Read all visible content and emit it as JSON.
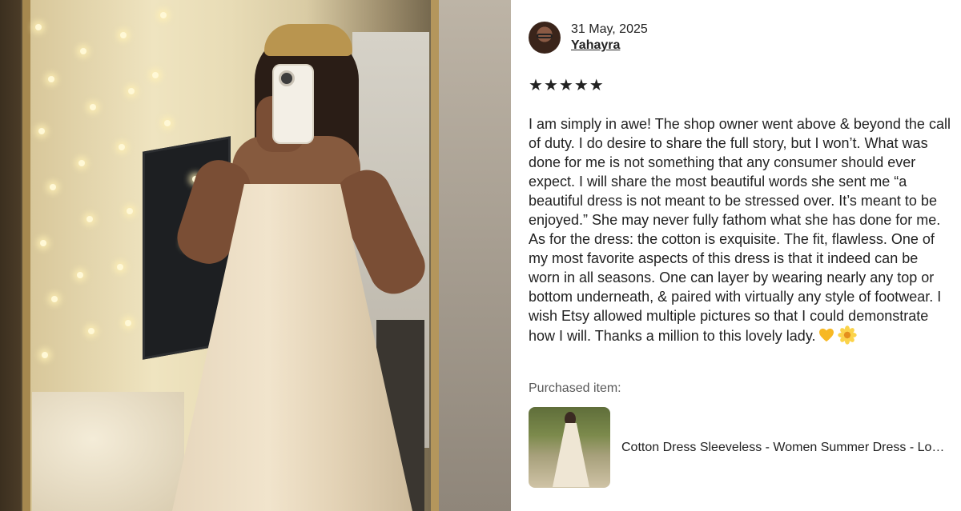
{
  "review": {
    "date": "31 May, 2025",
    "username": "Yahayra",
    "rating": 5,
    "stars": [
      "★",
      "★",
      "★",
      "★",
      "★"
    ],
    "text": "I am simply in awe! The shop owner went above & beyond the call of duty. I do desire to share the full story, but I won’t. What was done for me is not something that any consumer should ever expect. I will share the most beautiful words she sent me “a beautiful dress is not meant to be stressed over. It’s meant to be enjoyed.” She may never fully fathom what she has done for me. As for the dress: the cotton is exquisite. The fit, flawless. One of my most favorite aspects of this dress is that it indeed can be worn in all seasons. One can layer by wearing nearly any top or bottom underneath, & paired with virtually any style of footwear. I wish Etsy allowed multiple pictures so that I could demonstrate how I will. Thanks a million to this lovely lady.",
    "emojis": [
      "yellow-heart-icon",
      "blossom-icon"
    ]
  },
  "purchased": {
    "label": "Purchased item:",
    "title": "Cotton Dress Sleeveless - Women Summer Dress - Long Maxi Dress"
  },
  "colors": {
    "text": "#222222",
    "muted": "#595959",
    "background": "#ffffff"
  }
}
